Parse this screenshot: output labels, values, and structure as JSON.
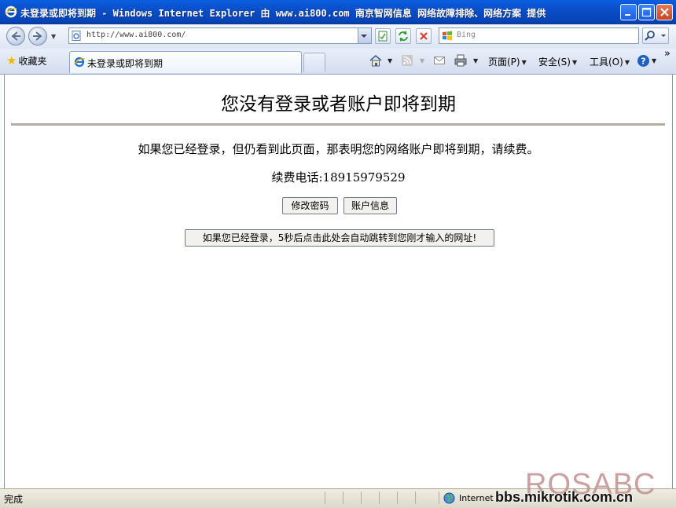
{
  "window": {
    "title": "未登录或即将到期 - Windows Internet Explorer 由 www.ai800.com 南京智网信息 网络故障排除、网络方案 提供"
  },
  "address_bar": {
    "url": "http://www.ai800.com/",
    "search_placeholder": "Bing"
  },
  "favorites": {
    "label": "收藏夹"
  },
  "tab": {
    "label": "未登录或即将到期"
  },
  "command_bar": {
    "page": "页面(P)",
    "safety": "安全(S)",
    "tools": "工具(O)",
    "more": "»"
  },
  "content": {
    "heading": "您没有登录或者账户即将到期",
    "message": "如果您已经登录，但仍看到此页面，那表明您的网络账户即将到期，请续费。",
    "phone": "续费电话:18915979529",
    "change_password_button": "修改密码",
    "account_info_button": "账户信息",
    "redirect_button": "如果您已经登录，5秒后点击此处会自动跳转到您刚才输入的网址!"
  },
  "status_bar": {
    "status": "完成",
    "zone": "Internet"
  },
  "watermark": {
    "logo": "ROSABC",
    "site": "bbs.mikrotik.com.cn"
  },
  "colors": {
    "titlebar": "#0a4ec8",
    "rule": "#b4aca2",
    "watermark": "#c29090"
  }
}
